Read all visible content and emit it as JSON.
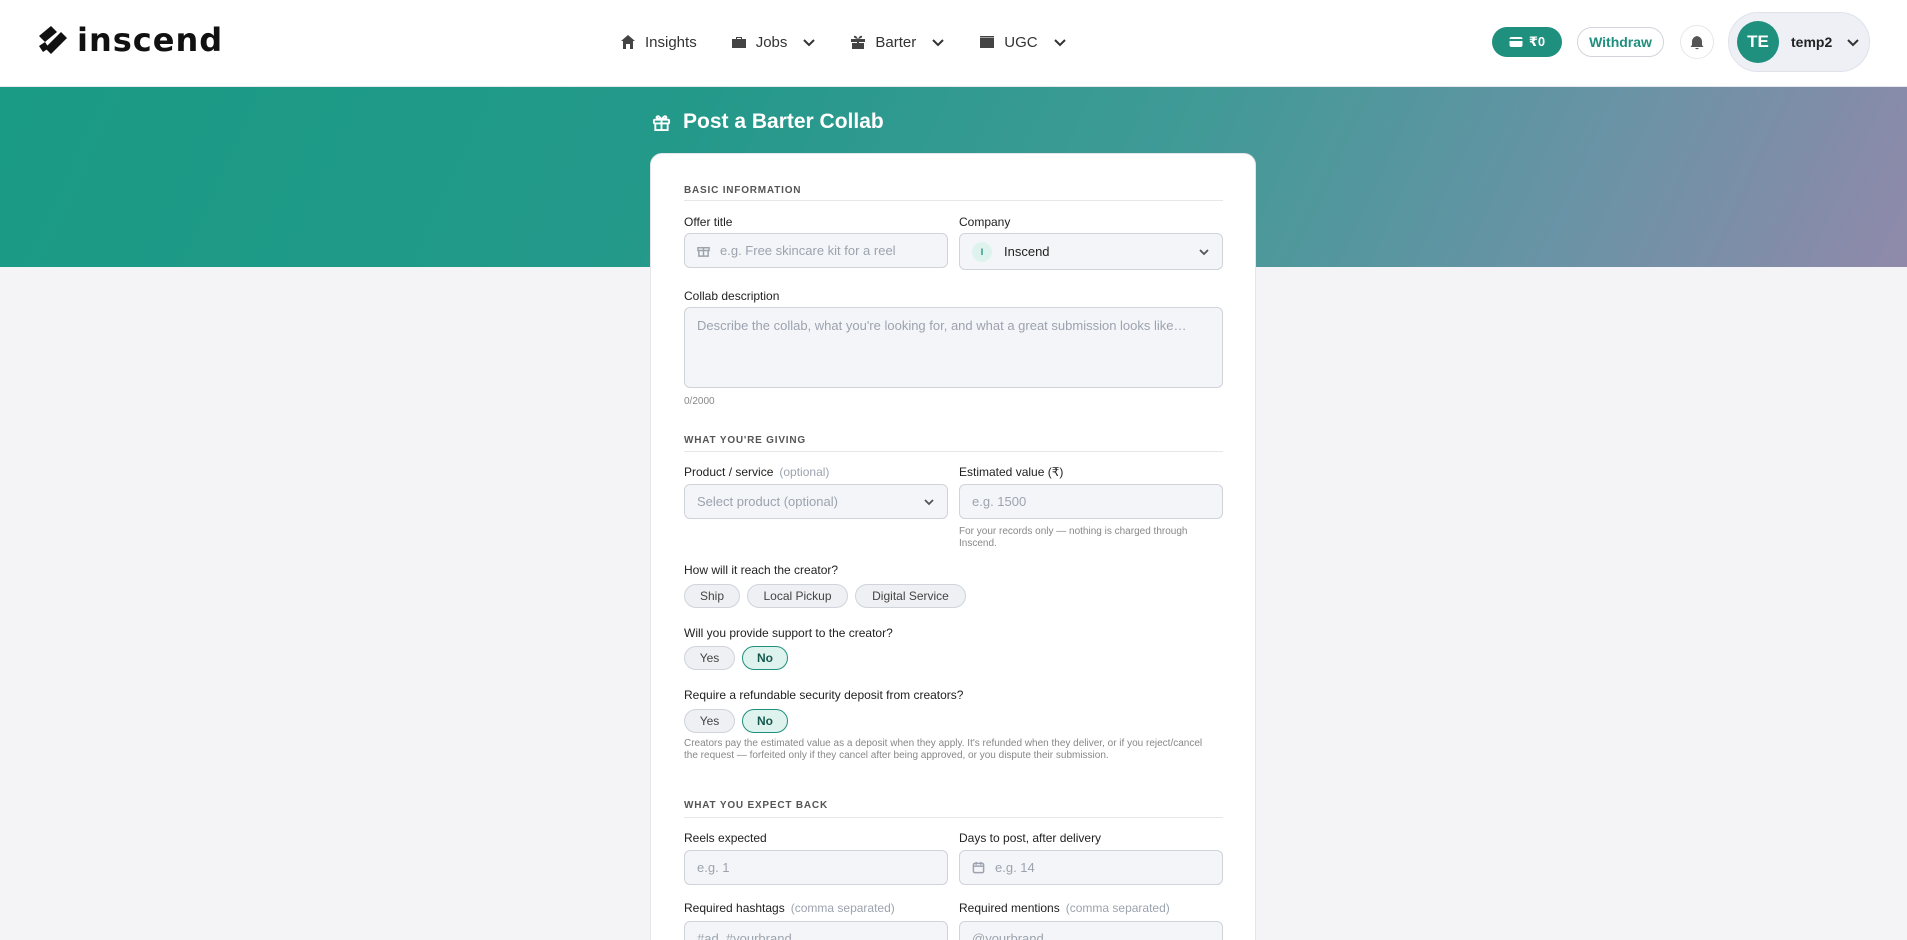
{
  "header": {
    "logo_text": "inscend",
    "nav": [
      {
        "label": "Insights",
        "icon": "home-icon",
        "has_dropdown": false
      },
      {
        "label": "Jobs",
        "icon": "briefcase-icon",
        "has_dropdown": true
      },
      {
        "label": "Barter",
        "icon": "gift-icon",
        "has_dropdown": true
      },
      {
        "label": "UGC",
        "icon": "clapperboard-icon",
        "has_dropdown": true
      }
    ],
    "wallet_balance": "₹0",
    "withdraw_label": "Withdraw",
    "user": {
      "initials": "TE",
      "name": "temp2"
    }
  },
  "page": {
    "title": "Post a Barter Collab"
  },
  "form": {
    "basic": {
      "section_title": "BASIC INFORMATION",
      "offer_title_label": "Offer title",
      "offer_title_placeholder": "e.g. Free skincare kit for a reel",
      "company_label": "Company",
      "company_value": "Inscend",
      "company_initial": "I",
      "description_label": "Collab description",
      "description_placeholder": "Describe the collab, what you're looking for, and what a great submission looks like…",
      "char_count": "0/2000"
    },
    "giving": {
      "section_title": "WHAT YOU'RE GIVING",
      "product_label": "Product / service",
      "product_optional": "(optional)",
      "product_placeholder": "Select product (optional)",
      "value_label": "Estimated value (₹)",
      "value_placeholder": "e.g. 1500",
      "value_hint": "For your records only — nothing is charged through Inscend.",
      "delivery_question": "How will it reach the creator?",
      "delivery_options": [
        "Ship",
        "Local Pickup",
        "Digital Service"
      ],
      "support_question": "Will you provide support to the creator?",
      "support_options": [
        "Yes",
        "No"
      ],
      "support_selected": "No",
      "deposit_question": "Require a refundable security deposit from creators?",
      "deposit_options": [
        "Yes",
        "No"
      ],
      "deposit_selected": "No",
      "deposit_hint": "Creators pay the estimated value as a deposit when they apply. It's refunded when they deliver, or if you reject/cancel the request — forfeited only if they cancel after being approved, or you dispute their submission."
    },
    "expect": {
      "section_title": "WHAT YOU EXPECT BACK",
      "reels_label": "Reels expected",
      "reels_placeholder": "e.g. 1",
      "days_label": "Days to post, after delivery",
      "days_placeholder": "e.g. 14",
      "hashtags_label": "Required hashtags",
      "hashtags_note": "(comma separated)",
      "hashtags_placeholder": "#ad, #yourbrand",
      "mentions_label": "Required mentions",
      "mentions_note": "(comma separated)",
      "mentions_placeholder": "@yourbrand"
    }
  },
  "colors": {
    "accent": "#1f8f7e",
    "accent_light": "#dff3ee"
  }
}
